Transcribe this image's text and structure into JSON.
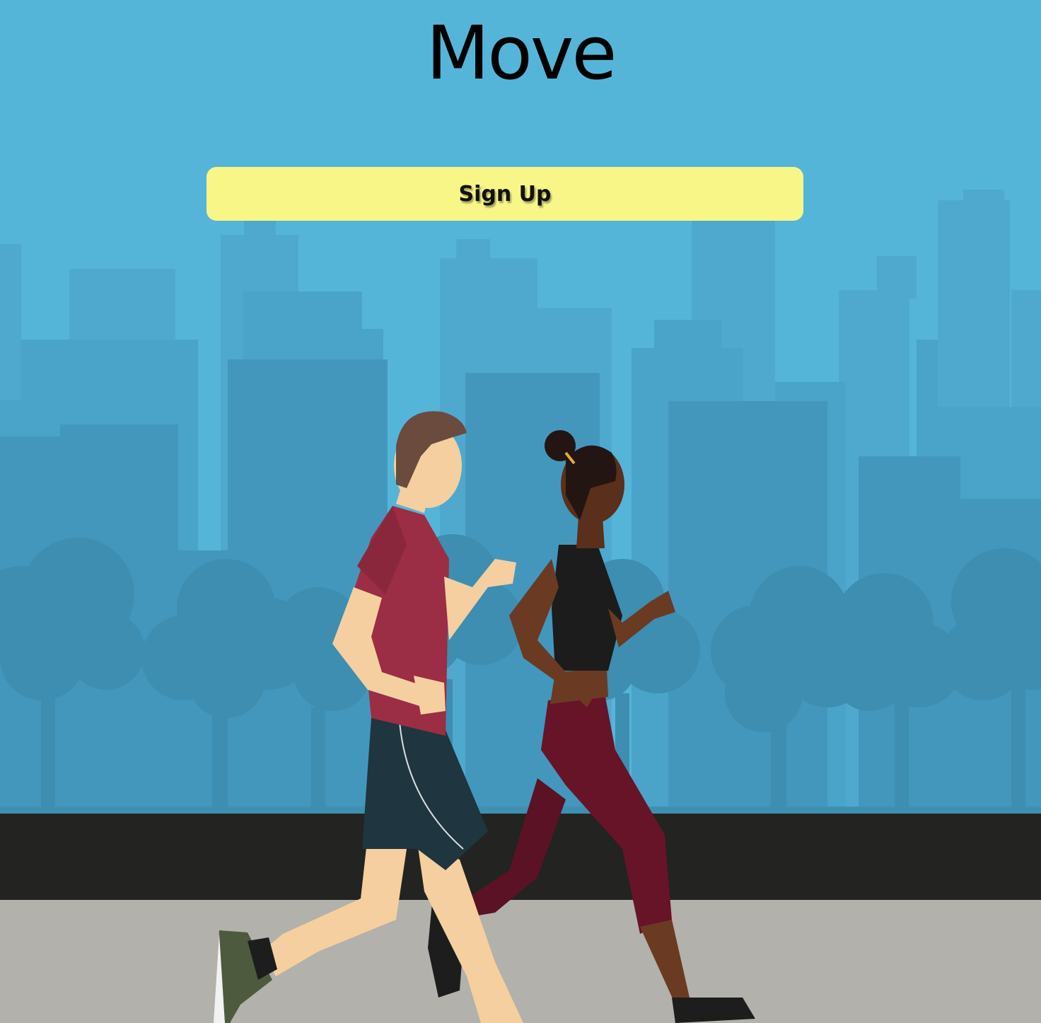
{
  "app": {
    "title": "Move"
  },
  "actions": {
    "signup_label": "Sign Up"
  },
  "hero": {
    "illustration": "two-joggers-city-park",
    "colors": {
      "sky": "#55b5d9",
      "button": "#f9f688",
      "road": "#232321",
      "sidewalk": "#b2b1ab"
    }
  }
}
